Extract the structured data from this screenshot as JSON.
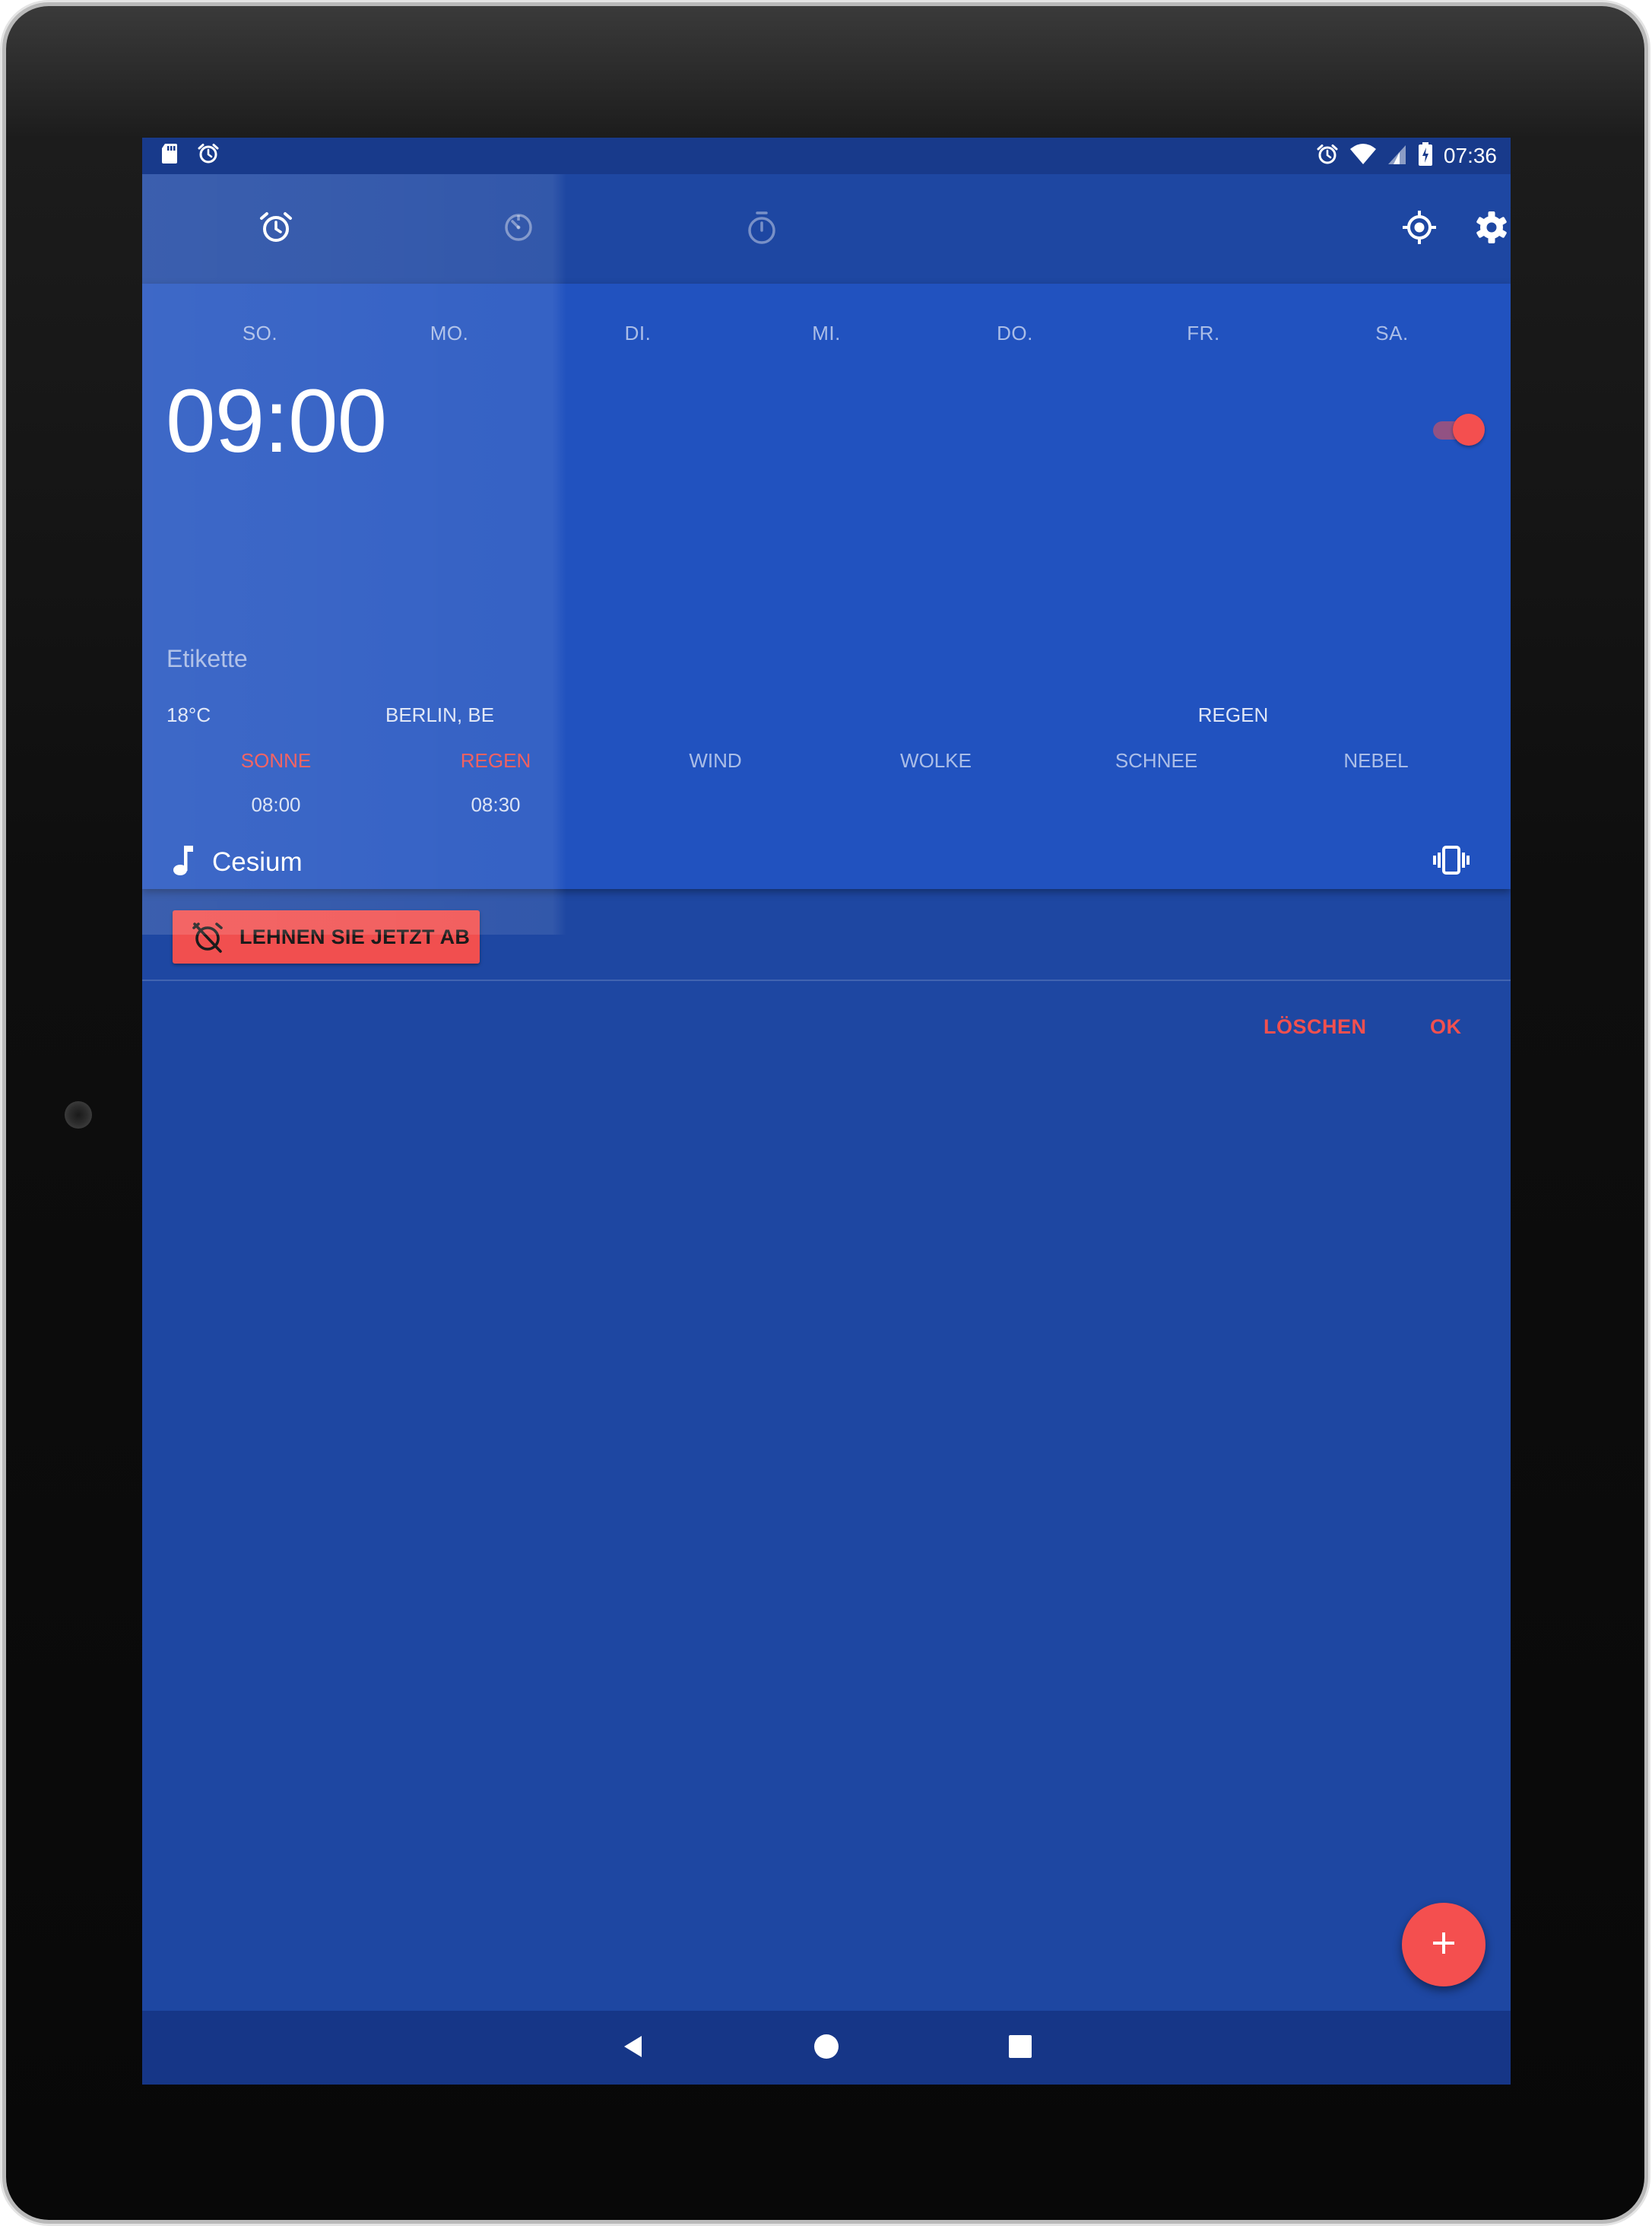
{
  "status_bar": {
    "time": "07:36",
    "left_icons": [
      "sd-card-icon",
      "alarm-icon"
    ],
    "right_icons": [
      "alarm-icon",
      "wifi-icon",
      "cell-signal-icon",
      "battery-charging-icon"
    ]
  },
  "app_bar": {
    "tabs": [
      {
        "icon": "alarm-clock-icon",
        "selected": true
      },
      {
        "icon": "timer-icon",
        "selected": false
      },
      {
        "icon": "stopwatch-icon",
        "selected": false
      }
    ],
    "actions": [
      "my-location-icon",
      "settings-gear-icon"
    ]
  },
  "alarm": {
    "days": [
      "SO.",
      "MO.",
      "DI.",
      "MI.",
      "DO.",
      "FR.",
      "SA."
    ],
    "time": "09:00",
    "enabled": true,
    "label_placeholder": "Etikette",
    "weather": {
      "temperature": "18°C",
      "location": "BERLIN,  BE",
      "condition": "REGEN",
      "conditions": [
        {
          "label": "SONNE",
          "active": true,
          "time": "08:00"
        },
        {
          "label": "REGEN",
          "active": true,
          "time": "08:30"
        },
        {
          "label": "WIND",
          "active": false,
          "time": ""
        },
        {
          "label": "WOLKE",
          "active": false,
          "time": ""
        },
        {
          "label": "SCHNEE",
          "active": false,
          "time": ""
        },
        {
          "label": "NEBEL",
          "active": false,
          "time": ""
        }
      ]
    },
    "ringtone": "Cesium",
    "dismiss_button": "LEHNEN SIE JETZT AB",
    "delete_button": "LÖSCHEN",
    "ok_button": "OK"
  },
  "colors": {
    "primary": "#1e47a2",
    "card": "#2152bf",
    "accent": "#f44f4f",
    "status_bar": "#183a8b",
    "nav_bar": "#163687"
  },
  "fab": {
    "icon": "add-icon"
  },
  "nav_bar": {
    "buttons": [
      "back-icon",
      "home-icon",
      "recents-icon"
    ]
  }
}
